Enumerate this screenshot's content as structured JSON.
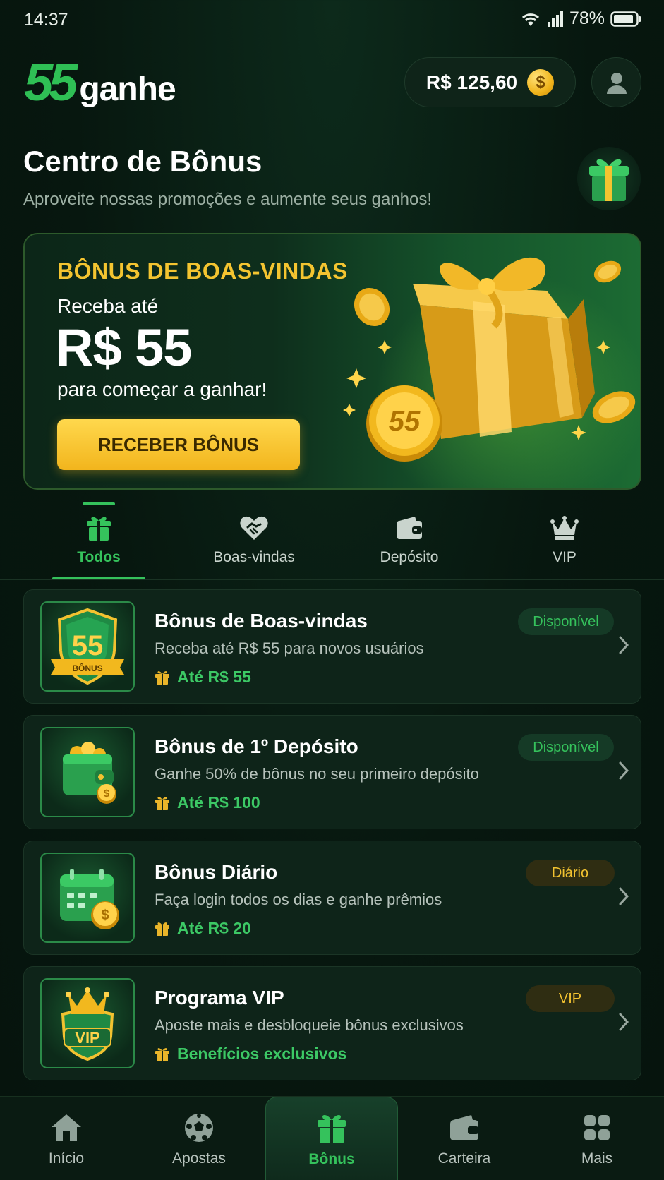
{
  "status_bar": {
    "time": "14:37",
    "battery": "78%"
  },
  "header": {
    "logo_number": "55",
    "logo_word": "ganhe",
    "balance": "R$ 125,60",
    "coin_symbol": "$"
  },
  "page": {
    "title": "Centro de Bônus",
    "subtitle": "Aproveite nossas promoções e aumente seus ganhos!"
  },
  "hero": {
    "label": "BÔNUS DE BOAS-VINDAS",
    "line1": "Receba até",
    "amount": "R$ 55",
    "line2": "para começar a ganhar!",
    "cta": "RECEBER BÔNUS",
    "coin_number": "55"
  },
  "tabs": [
    {
      "label": "Todos",
      "icon": "gift-icon",
      "active": true
    },
    {
      "label": "Boas-vindas",
      "icon": "heart-handshake-icon",
      "active": false
    },
    {
      "label": "Depósito",
      "icon": "wallet-icon",
      "active": false
    },
    {
      "label": "VIP",
      "icon": "crown-icon",
      "active": false
    }
  ],
  "bonuses": [
    {
      "title": "Bônus de Boas-vindas",
      "description": "Receba até R$ 55 para novos usuários",
      "reward": "Até R$ 55",
      "badge": "Disponível",
      "badge_style": "green",
      "thumb": "shield-55-icon",
      "thumb_number": "55",
      "thumb_ribbon": "BÔNUS"
    },
    {
      "title": "Bônus de 1º Depósito",
      "description": "Ganhe 50% de bônus no seu primeiro depósito",
      "reward": "Até R$ 100",
      "badge": "Disponível",
      "badge_style": "green",
      "thumb": "wallet-coins-icon"
    },
    {
      "title": "Bônus Diário",
      "description": "Faça login todos os dias e ganhe prêmios",
      "reward": "Até R$ 20",
      "badge": "Diário",
      "badge_style": "gold",
      "thumb": "calendar-coin-icon"
    },
    {
      "title": "Programa VIP",
      "description": "Aposte mais e desbloqueie bônus exclusivos",
      "reward": "Benefícios exclusivos",
      "badge": "VIP",
      "badge_style": "gold",
      "thumb": "vip-crown-shield-icon",
      "thumb_text": "VIP"
    }
  ],
  "bottom_nav": [
    {
      "label": "Início",
      "icon": "home-icon",
      "active": false
    },
    {
      "label": "Apostas",
      "icon": "soccer-ball-icon",
      "active": false
    },
    {
      "label": "Bônus",
      "icon": "gift-icon",
      "active": true
    },
    {
      "label": "Carteira",
      "icon": "wallet-icon",
      "active": false
    },
    {
      "label": "Mais",
      "icon": "grid-icon",
      "active": false
    }
  ],
  "colors": {
    "accent": "#35c25c",
    "gold": "#f4c430",
    "background": "#07170f",
    "card": "#0e2419"
  }
}
